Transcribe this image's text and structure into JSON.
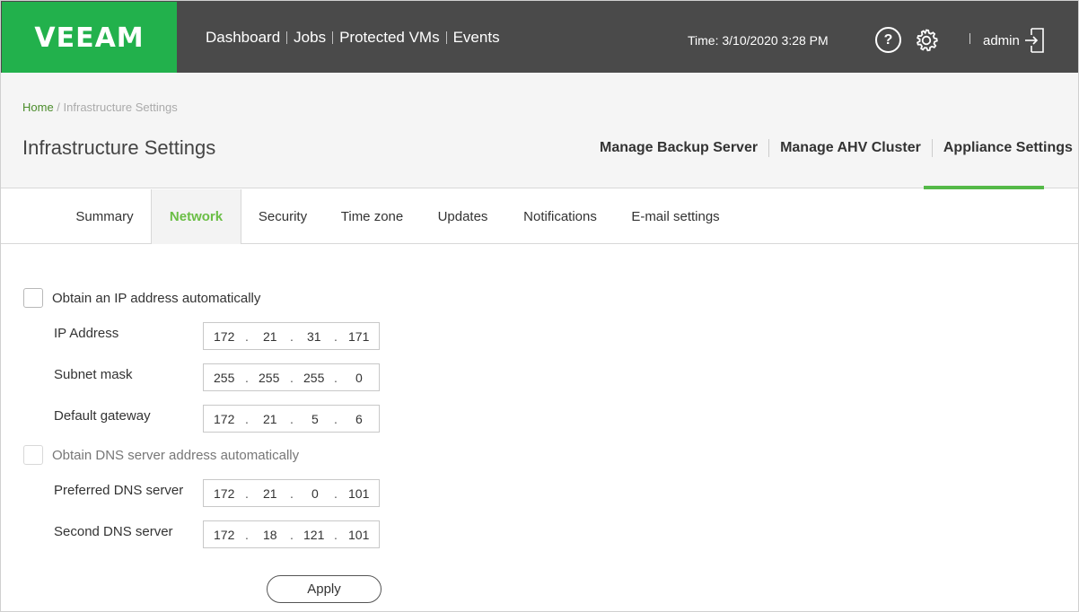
{
  "app": {
    "logo": "VEEAM",
    "nav": [
      "Dashboard",
      "Jobs",
      "Protected VMs",
      "Events"
    ],
    "time": "Time: 3/10/2020 3:28 PM",
    "help_glyph": "?",
    "user": "admin",
    "icons": [
      "help-icon",
      "gear-icon",
      "logout-icon"
    ]
  },
  "header": {
    "breadcrumb_home": "Home",
    "breadcrumb_sep": " / ",
    "breadcrumb_current": "Infrastructure Settings",
    "title": "Infrastructure Settings",
    "sections": [
      "Manage Backup Server",
      "Manage AHV Cluster",
      "Appliance Settings"
    ],
    "active_section": "Appliance Settings"
  },
  "tabs": {
    "items": [
      "Summary",
      "Network",
      "Security",
      "Time zone",
      "Updates",
      "Notifications",
      "E-mail settings"
    ],
    "active": "Network"
  },
  "form": {
    "auto_ip_label": "Obtain an IP address automatically",
    "auto_ip_checked": false,
    "ip_label": "IP Address",
    "ip": [
      "172",
      "21",
      "31",
      "171"
    ],
    "subnet_label": "Subnet mask",
    "subnet": [
      "255",
      "255",
      "255",
      "0"
    ],
    "gateway_label": "Default gateway",
    "gateway": [
      "172",
      "21",
      "5",
      "6"
    ],
    "auto_dns_label": "Obtain DNS server address automatically",
    "auto_dns_checked": false,
    "pref_dns_label": "Preferred DNS server",
    "pref_dns": [
      "172",
      "21",
      "0",
      "101"
    ],
    "second_dns_label": "Second DNS server",
    "second_dns": [
      "172",
      "18",
      "121",
      "101"
    ],
    "apply_label": "Apply"
  },
  "colors": {
    "brand_green": "#22b14c",
    "active_green": "#54b948",
    "topbar": "#4a4a4a"
  }
}
